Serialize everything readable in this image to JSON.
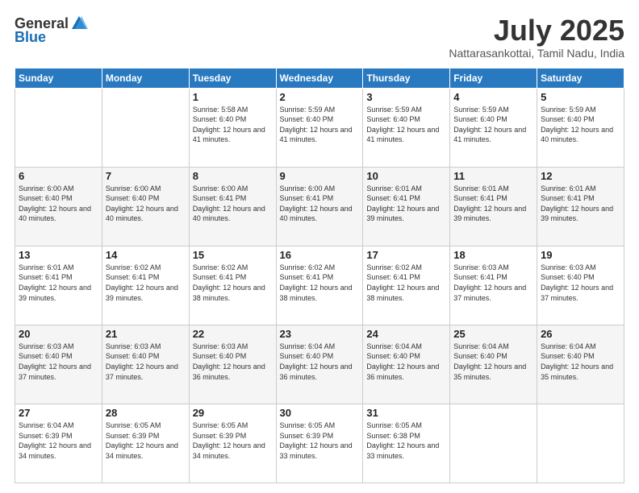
{
  "logo": {
    "general": "General",
    "blue": "Blue"
  },
  "title": {
    "month": "July 2025",
    "location": "Nattarasankottai, Tamil Nadu, India"
  },
  "weekdays": [
    "Sunday",
    "Monday",
    "Tuesday",
    "Wednesday",
    "Thursday",
    "Friday",
    "Saturday"
  ],
  "weeks": [
    [
      {
        "day": "",
        "info": ""
      },
      {
        "day": "",
        "info": ""
      },
      {
        "day": "1",
        "info": "Sunrise: 5:58 AM\nSunset: 6:40 PM\nDaylight: 12 hours and 41 minutes."
      },
      {
        "day": "2",
        "info": "Sunrise: 5:59 AM\nSunset: 6:40 PM\nDaylight: 12 hours and 41 minutes."
      },
      {
        "day": "3",
        "info": "Sunrise: 5:59 AM\nSunset: 6:40 PM\nDaylight: 12 hours and 41 minutes."
      },
      {
        "day": "4",
        "info": "Sunrise: 5:59 AM\nSunset: 6:40 PM\nDaylight: 12 hours and 41 minutes."
      },
      {
        "day": "5",
        "info": "Sunrise: 5:59 AM\nSunset: 6:40 PM\nDaylight: 12 hours and 40 minutes."
      }
    ],
    [
      {
        "day": "6",
        "info": "Sunrise: 6:00 AM\nSunset: 6:40 PM\nDaylight: 12 hours and 40 minutes."
      },
      {
        "day": "7",
        "info": "Sunrise: 6:00 AM\nSunset: 6:40 PM\nDaylight: 12 hours and 40 minutes."
      },
      {
        "day": "8",
        "info": "Sunrise: 6:00 AM\nSunset: 6:41 PM\nDaylight: 12 hours and 40 minutes."
      },
      {
        "day": "9",
        "info": "Sunrise: 6:00 AM\nSunset: 6:41 PM\nDaylight: 12 hours and 40 minutes."
      },
      {
        "day": "10",
        "info": "Sunrise: 6:01 AM\nSunset: 6:41 PM\nDaylight: 12 hours and 39 minutes."
      },
      {
        "day": "11",
        "info": "Sunrise: 6:01 AM\nSunset: 6:41 PM\nDaylight: 12 hours and 39 minutes."
      },
      {
        "day": "12",
        "info": "Sunrise: 6:01 AM\nSunset: 6:41 PM\nDaylight: 12 hours and 39 minutes."
      }
    ],
    [
      {
        "day": "13",
        "info": "Sunrise: 6:01 AM\nSunset: 6:41 PM\nDaylight: 12 hours and 39 minutes."
      },
      {
        "day": "14",
        "info": "Sunrise: 6:02 AM\nSunset: 6:41 PM\nDaylight: 12 hours and 39 minutes."
      },
      {
        "day": "15",
        "info": "Sunrise: 6:02 AM\nSunset: 6:41 PM\nDaylight: 12 hours and 38 minutes."
      },
      {
        "day": "16",
        "info": "Sunrise: 6:02 AM\nSunset: 6:41 PM\nDaylight: 12 hours and 38 minutes."
      },
      {
        "day": "17",
        "info": "Sunrise: 6:02 AM\nSunset: 6:41 PM\nDaylight: 12 hours and 38 minutes."
      },
      {
        "day": "18",
        "info": "Sunrise: 6:03 AM\nSunset: 6:41 PM\nDaylight: 12 hours and 37 minutes."
      },
      {
        "day": "19",
        "info": "Sunrise: 6:03 AM\nSunset: 6:40 PM\nDaylight: 12 hours and 37 minutes."
      }
    ],
    [
      {
        "day": "20",
        "info": "Sunrise: 6:03 AM\nSunset: 6:40 PM\nDaylight: 12 hours and 37 minutes."
      },
      {
        "day": "21",
        "info": "Sunrise: 6:03 AM\nSunset: 6:40 PM\nDaylight: 12 hours and 37 minutes."
      },
      {
        "day": "22",
        "info": "Sunrise: 6:03 AM\nSunset: 6:40 PM\nDaylight: 12 hours and 36 minutes."
      },
      {
        "day": "23",
        "info": "Sunrise: 6:04 AM\nSunset: 6:40 PM\nDaylight: 12 hours and 36 minutes."
      },
      {
        "day": "24",
        "info": "Sunrise: 6:04 AM\nSunset: 6:40 PM\nDaylight: 12 hours and 36 minutes."
      },
      {
        "day": "25",
        "info": "Sunrise: 6:04 AM\nSunset: 6:40 PM\nDaylight: 12 hours and 35 minutes."
      },
      {
        "day": "26",
        "info": "Sunrise: 6:04 AM\nSunset: 6:40 PM\nDaylight: 12 hours and 35 minutes."
      }
    ],
    [
      {
        "day": "27",
        "info": "Sunrise: 6:04 AM\nSunset: 6:39 PM\nDaylight: 12 hours and 34 minutes."
      },
      {
        "day": "28",
        "info": "Sunrise: 6:05 AM\nSunset: 6:39 PM\nDaylight: 12 hours and 34 minutes."
      },
      {
        "day": "29",
        "info": "Sunrise: 6:05 AM\nSunset: 6:39 PM\nDaylight: 12 hours and 34 minutes."
      },
      {
        "day": "30",
        "info": "Sunrise: 6:05 AM\nSunset: 6:39 PM\nDaylight: 12 hours and 33 minutes."
      },
      {
        "day": "31",
        "info": "Sunrise: 6:05 AM\nSunset: 6:38 PM\nDaylight: 12 hours and 33 minutes."
      },
      {
        "day": "",
        "info": ""
      },
      {
        "day": "",
        "info": ""
      }
    ]
  ]
}
